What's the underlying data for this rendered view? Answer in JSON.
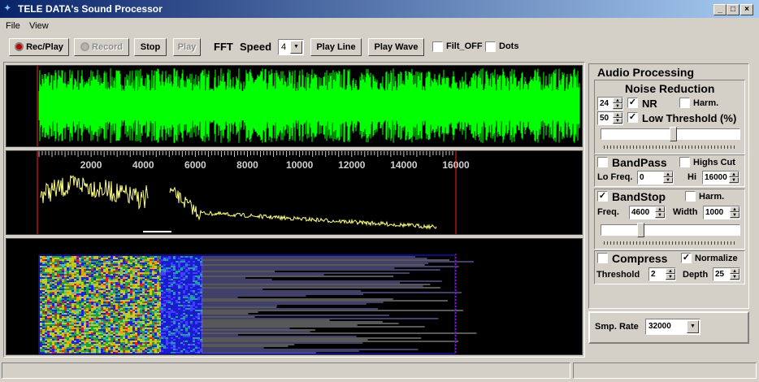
{
  "window": {
    "title": "TELE DATA's Sound Processor",
    "minimize": "_",
    "maximize": "□",
    "close": "×"
  },
  "menu": [
    "File",
    "View"
  ],
  "toolbar": {
    "rec_play": "Rec/Play",
    "record": "Record",
    "stop": "Stop",
    "play": "Play",
    "fft_label": "FFT",
    "speed_label": "Speed",
    "speed_value": "4",
    "play_line": "Play Line",
    "play_wave": "Play Wave",
    "filt_off": "Filt_OFF",
    "filt_off_checked": false,
    "dots": "Dots",
    "dots_checked": false
  },
  "spectrum": {
    "ticks": [
      "2000",
      "4000",
      "6000",
      "8000",
      "10000",
      "12000",
      "14000",
      "16000"
    ]
  },
  "audio": {
    "title": "Audio Processing",
    "noise_reduction": {
      "title": "Noise Reduction",
      "nr_value": "24",
      "nr_label": "NR",
      "nr_checked": true,
      "harm_label": "Harm.",
      "harm_checked": false,
      "low_value": "50",
      "low_label": "Low Threshold (%)",
      "low_checked": true,
      "slider_level": 0.52
    },
    "bandpass": {
      "label": "BandPass",
      "checked": false,
      "highs_cut": "Highs Cut",
      "highs_cut_checked": false,
      "lo_label": "Lo Freq.",
      "lo_value": "0",
      "hi_label": "Hi",
      "hi_value": "16000"
    },
    "bandstop": {
      "label": "BandStop",
      "checked": true,
      "harm_label": "Harm.",
      "harm_checked": false,
      "freq_label": "Freq.",
      "freq_value": "4600",
      "width_label": "Width",
      "width_value": "1000",
      "slider_level": 0.27
    },
    "compress": {
      "label": "Compress",
      "checked": false,
      "normalize": "Normalize",
      "normalize_checked": true,
      "threshold_label": "Threshold",
      "threshold_value": "2",
      "depth_label": "Depth",
      "depth_value": "25"
    },
    "sample_rate": {
      "label": "Smp. Rate",
      "value": "32000"
    }
  },
  "colors": {
    "waveform": "#00ff00",
    "spectrum": "#ffff80",
    "marker": "#ff2020",
    "title_bar": "#0a246a"
  }
}
